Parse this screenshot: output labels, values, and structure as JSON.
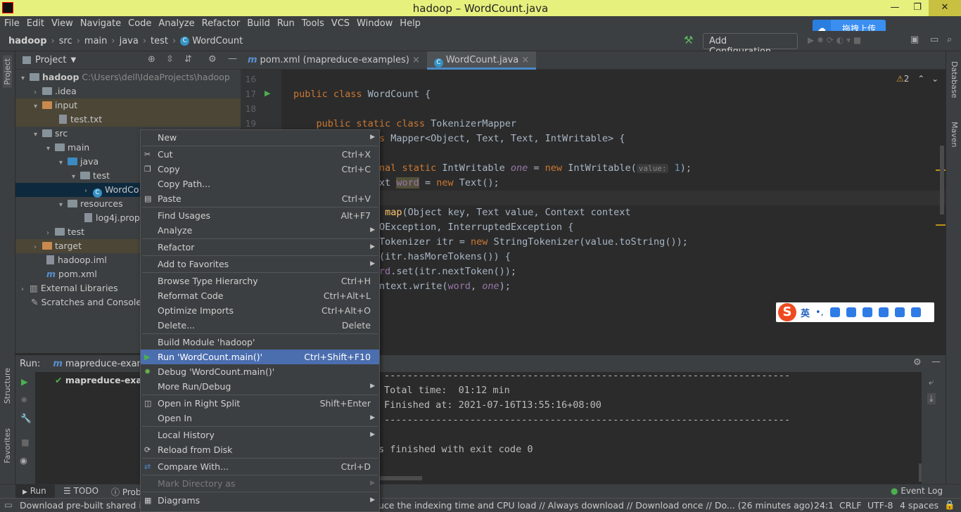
{
  "window": {
    "title": "hadoop – WordCount.java"
  },
  "menu": [
    "File",
    "Edit",
    "View",
    "Navigate",
    "Code",
    "Analyze",
    "Refactor",
    "Build",
    "Run",
    "Tools",
    "VCS",
    "Window",
    "Help"
  ],
  "breadcrumb": [
    "hadoop",
    "src",
    "main",
    "java",
    "test",
    "WordCount"
  ],
  "toolbar": {
    "add_config": "Add Configuration...",
    "upload": "拖拽上传"
  },
  "left_stripe": {
    "project": "Project",
    "structure": "Structure",
    "favorites": "Favorites"
  },
  "right_stripe": {
    "database": "Database",
    "maven": "Maven"
  },
  "project": {
    "header": "Project",
    "tree": [
      {
        "label": "hadoop",
        "path": "C:\\Users\\dell\\IdeaProjects\\hadoop"
      },
      {
        "label": ".idea"
      },
      {
        "label": "input"
      },
      {
        "label": "test.txt"
      },
      {
        "label": "src"
      },
      {
        "label": "main"
      },
      {
        "label": "java"
      },
      {
        "label": "test"
      },
      {
        "label": "WordCo"
      },
      {
        "label": "resources"
      },
      {
        "label": "log4j.prope"
      },
      {
        "label": "test"
      },
      {
        "label": "target"
      },
      {
        "label": "hadoop.iml"
      },
      {
        "label": "pom.xml"
      },
      {
        "label": "External Libraries"
      },
      {
        "label": "Scratches and Consoles"
      }
    ]
  },
  "editor": {
    "tabs": [
      "pom.xml (mapreduce-examples)",
      "WordCount.java"
    ],
    "warnings": "2",
    "line_numbers": [
      "16",
      "17",
      "18",
      "19"
    ],
    "hint_value": "value:"
  },
  "context_menu": [
    {
      "label": "New",
      "shortcut": "",
      "submenu": true
    },
    {
      "label": "Cut",
      "shortcut": "Ctrl+X"
    },
    {
      "label": "Copy",
      "shortcut": "Ctrl+C"
    },
    {
      "label": "Copy Path...",
      "shortcut": ""
    },
    {
      "label": "Paste",
      "shortcut": "Ctrl+V"
    },
    {
      "label": "Find Usages",
      "shortcut": "Alt+F7"
    },
    {
      "label": "Analyze",
      "shortcut": "",
      "submenu": true
    },
    {
      "label": "Refactor",
      "shortcut": "",
      "submenu": true
    },
    {
      "label": "Add to Favorites",
      "shortcut": "",
      "submenu": true
    },
    {
      "label": "Browse Type Hierarchy",
      "shortcut": "Ctrl+H"
    },
    {
      "label": "Reformat Code",
      "shortcut": "Ctrl+Alt+L"
    },
    {
      "label": "Optimize Imports",
      "shortcut": "Ctrl+Alt+O"
    },
    {
      "label": "Delete...",
      "shortcut": "Delete"
    },
    {
      "label": "Build Module 'hadoop'",
      "shortcut": ""
    },
    {
      "label": "Run 'WordCount.main()'",
      "shortcut": "Ctrl+Shift+F10"
    },
    {
      "label": "Debug 'WordCount.main()'",
      "shortcut": ""
    },
    {
      "label": "More Run/Debug",
      "shortcut": "",
      "submenu": true
    },
    {
      "label": "Open in Right Split",
      "shortcut": "Shift+Enter"
    },
    {
      "label": "Open In",
      "shortcut": "",
      "submenu": true
    },
    {
      "label": "Local History",
      "shortcut": "",
      "submenu": true
    },
    {
      "label": "Reload from Disk",
      "shortcut": ""
    },
    {
      "label": "Compare With...",
      "shortcut": "Ctrl+D"
    },
    {
      "label": "Mark Directory as",
      "shortcut": "",
      "submenu": true,
      "disabled": true
    },
    {
      "label": "Diagrams",
      "shortcut": "",
      "submenu": true
    }
  ],
  "run": {
    "label": "Run:",
    "tab": "mapreduce-examp",
    "tree_item": "mapreduce-exam",
    "console": [
      "-----------------------------------------------------------------------",
      "Total time:  01:12 min",
      "Finished at: 2021-07-16T13:55:16+08:00",
      "-----------------------------------------------------------------------",
      "s finished with exit code 0"
    ]
  },
  "bottom_tabs": {
    "run": "Run",
    "todo": "TODO",
    "problems": "Prob",
    "event_log": "Event Log"
  },
  "status": {
    "left": "Download pre-built shared in",
    "middle": "uce the indexing time and CPU load // Always download // Download once // Do... (26 minutes ago)",
    "position": "24:1",
    "line_sep": "CRLF",
    "encoding": "UTF-8",
    "indent": "4 spaces"
  },
  "ime": {
    "lang": "英"
  }
}
